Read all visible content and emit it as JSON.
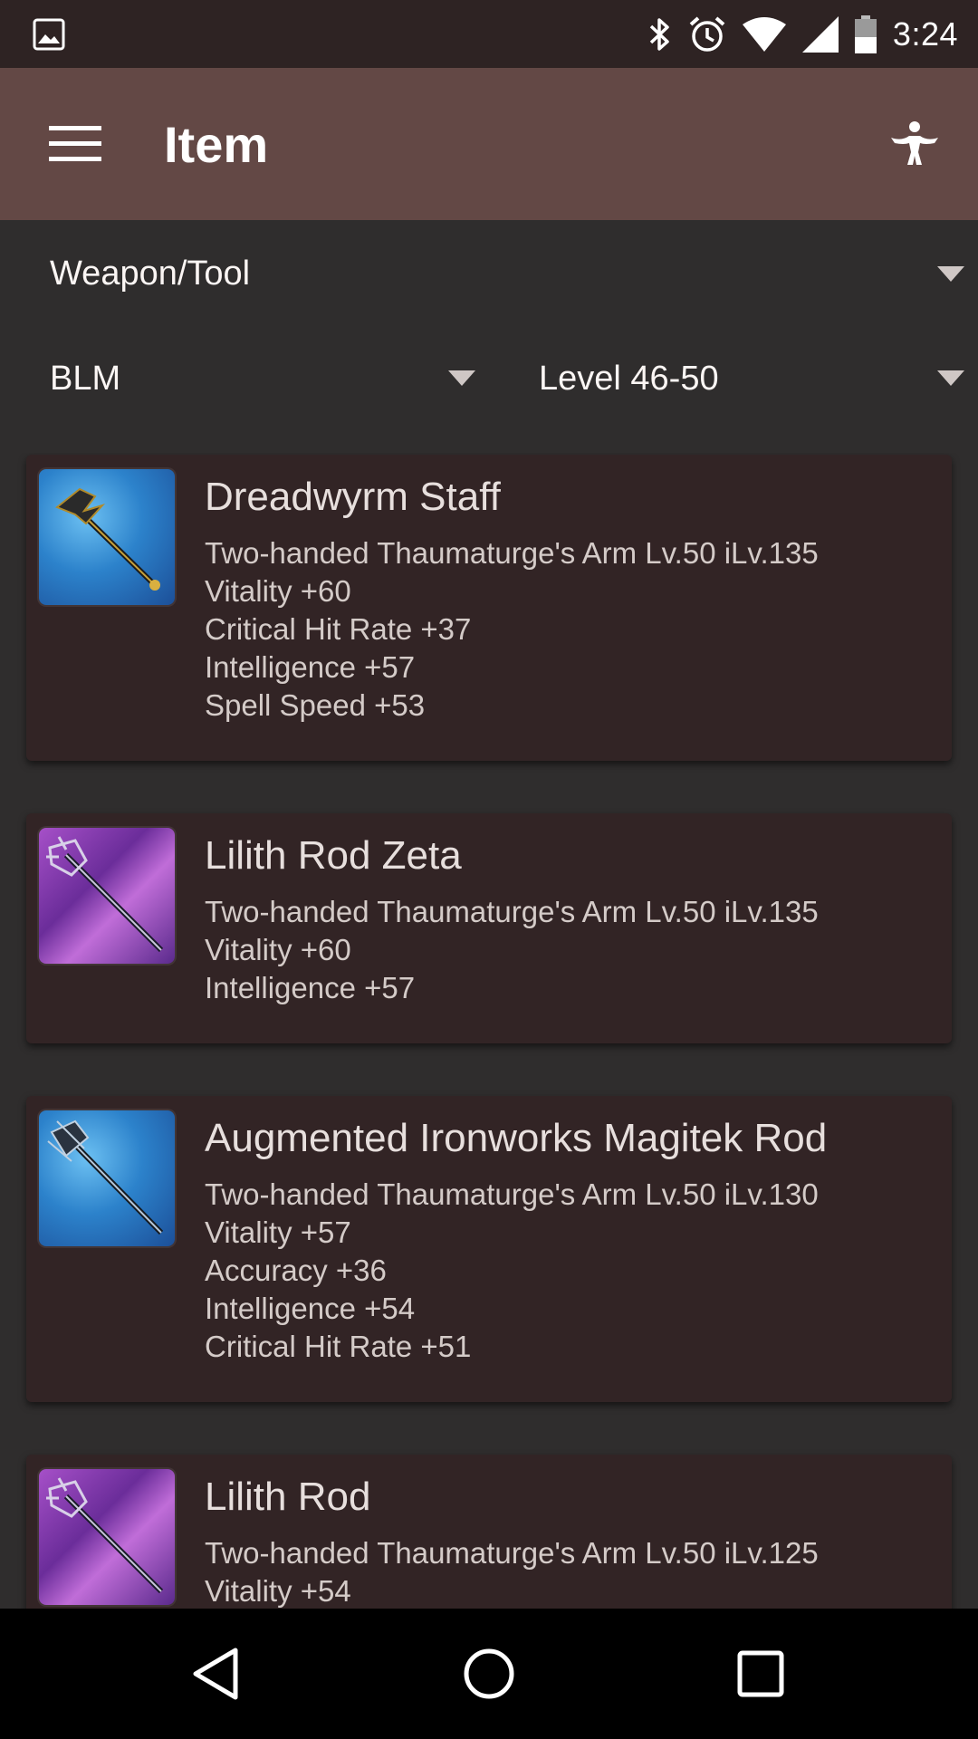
{
  "status_bar": {
    "time": "3:24",
    "icons": [
      "image-icon",
      "bluetooth-icon",
      "alarm-icon",
      "wifi-icon",
      "signal-icon",
      "battery-icon"
    ]
  },
  "app_bar": {
    "title": "Item",
    "menu_icon": "menu-icon",
    "action_icon": "character-icon",
    "background": "#634845"
  },
  "filters": {
    "category": "Weapon/Tool",
    "job": "BLM",
    "level": "Level 46-50"
  },
  "items": [
    {
      "name": "Dreadwyrm Staff",
      "type": "Two-handed Thaumaturge's Arm Lv.50 iLv.135",
      "stats": [
        "Vitality +60",
        "Critical Hit Rate +37",
        "Intelligence +57",
        "Spell Speed +53"
      ],
      "icon_color": "blue"
    },
    {
      "name": "Lilith Rod Zeta",
      "type": "Two-handed Thaumaturge's Arm Lv.50 iLv.135",
      "stats": [
        "Vitality +60",
        "Intelligence +57"
      ],
      "icon_color": "purple"
    },
    {
      "name": "Augmented Ironworks Magitek Rod",
      "type": "Two-handed Thaumaturge's Arm Lv.50 iLv.130",
      "stats": [
        "Vitality +57",
        "Accuracy +36",
        "Intelligence +54",
        "Critical Hit Rate +51"
      ],
      "icon_color": "blue"
    },
    {
      "name": "Lilith Rod",
      "type": "Two-handed Thaumaturge's Arm Lv.50 iLv.125",
      "stats": [
        "Vitality +54"
      ],
      "icon_color": "purple"
    }
  ],
  "nav_bar": {
    "buttons": [
      "back-icon",
      "home-icon",
      "recents-icon"
    ]
  }
}
